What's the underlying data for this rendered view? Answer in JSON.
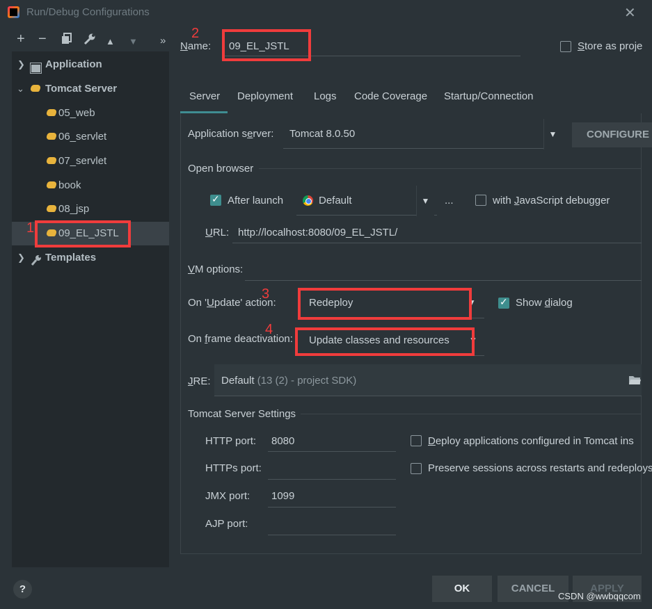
{
  "window": {
    "title": "Run/Debug Configurations"
  },
  "toolbar": {
    "add": "+",
    "remove": "−",
    "copy": "⧉",
    "wrench": "🔧",
    "up": "▲",
    "down": "▼",
    "more": "»"
  },
  "tree": {
    "application": "Application",
    "tomcat_server": "Tomcat Server",
    "items": [
      "05_web",
      "06_servlet",
      "07_servlet",
      "book",
      "08_jsp",
      "09_EL_JSTL"
    ],
    "templates": "Templates"
  },
  "annotations": {
    "n1": "1",
    "n2": "2",
    "n3": "3",
    "n4": "4"
  },
  "name": {
    "label": "Name:",
    "value": "09_EL_JSTL"
  },
  "store_as_project": {
    "label": "Store as proje",
    "checked": false
  },
  "tabs": [
    "Server",
    "Deployment",
    "Logs",
    "Code Coverage",
    "Startup/Connection"
  ],
  "server": {
    "app_server_label": "Application server:",
    "app_server_value": "Tomcat 8.0.50",
    "configure_label": "CONFIGURE",
    "open_browser_label": "Open browser",
    "after_launch_label": "After launch",
    "after_launch_checked": true,
    "browser_value": "Default",
    "ellipsis": "...",
    "js_debugger_label": "with JavaScript debugger",
    "js_debugger_checked": false,
    "url_label": "URL:",
    "url_value": "http://localhost:8080/09_EL_JSTL/",
    "vm_options_label": "VM options:",
    "on_update_label": "On 'Update' action:",
    "on_update_value": "Redeploy",
    "show_dialog_label": "Show dialog",
    "show_dialog_checked": true,
    "on_frame_label": "On frame deactivation:",
    "on_frame_value": "Update classes and resources",
    "jre_label": "JRE:",
    "jre_value": "Default",
    "jre_hint": "(13 (2) - project SDK)",
    "tomcat_settings_label": "Tomcat Server Settings",
    "http_port_label": "HTTP port:",
    "http_port_value": "8080",
    "https_port_label": "HTTPs port:",
    "https_port_value": "",
    "jmx_port_label": "JMX port:",
    "jmx_port_value": "1099",
    "ajp_port_label": "AJP port:",
    "ajp_port_value": "",
    "deploy_apps_label": "Deploy applications configured in Tomcat ins",
    "deploy_apps_checked": false,
    "preserve_sessions_label": "Preserve sessions across restarts and redeploys",
    "preserve_sessions_checked": false
  },
  "buttons": {
    "help": "?",
    "ok": "OK",
    "cancel": "CANCEL",
    "apply": "APPLY"
  },
  "watermark": "CSDN @wwbqqcom",
  "colors": {
    "accent": "#3f8d92",
    "annotation_red": "#f03c3c",
    "background": "#2b3338",
    "tree_background": "#23292d"
  }
}
